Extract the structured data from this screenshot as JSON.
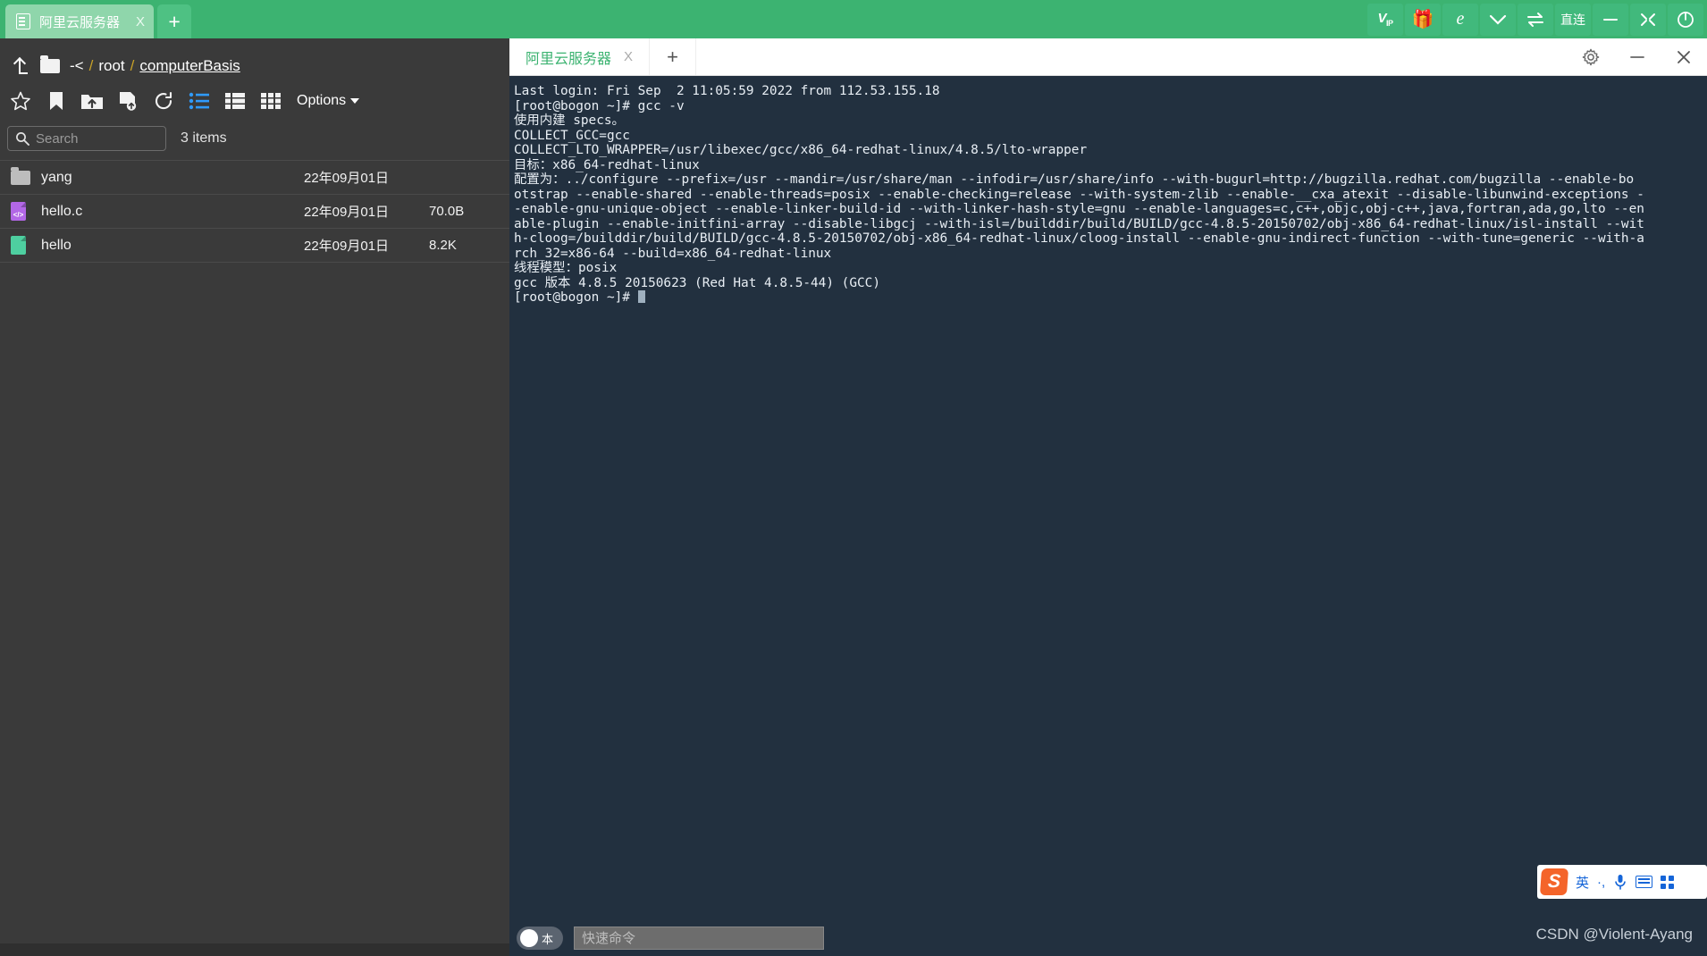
{
  "app": {
    "tab": {
      "title": "阿里云服务器",
      "close_label": "X",
      "icon": "server-icon"
    },
    "new_tab_label": "+",
    "tools": [
      {
        "name": "vip-button",
        "label": "V",
        "sub": "IP"
      },
      {
        "name": "gift-button",
        "label": "🎁"
      },
      {
        "name": "browser-button",
        "label": "e"
      },
      {
        "name": "chevron-down-button",
        "label": "⌄"
      },
      {
        "name": "transfer-button",
        "label": "⇆"
      },
      {
        "name": "direct-connect-button",
        "label": "直连"
      },
      {
        "name": "minimize-button",
        "label": "—"
      },
      {
        "name": "maximize-button",
        "label": "⤢"
      },
      {
        "name": "power-button",
        "label": "⏻"
      }
    ]
  },
  "filepanel": {
    "breadcrumb": {
      "prefix": "-<",
      "sep": "/",
      "root": "root",
      "current": "computerBasis"
    },
    "toolbar": {
      "icons": [
        "star-icon",
        "bookmark-icon",
        "upload-folder-icon",
        "new-file-icon",
        "refresh-icon",
        "list-view-icon",
        "detail-view-icon",
        "grid-view-icon"
      ],
      "options_label": "Options"
    },
    "search": {
      "placeholder": "Search",
      "value": ""
    },
    "items_count": "3 items",
    "files": [
      {
        "icon": "folder-icon",
        "name": "yang",
        "date": "22年09月01日",
        "size": ""
      },
      {
        "icon": "c-file-icon",
        "name": "hello.c",
        "date": "22年09月01日",
        "size": "70.0B"
      },
      {
        "icon": "bin-file-icon",
        "name": "hello",
        "date": "22年09月01日",
        "size": "8.2K"
      }
    ]
  },
  "terminal": {
    "tab": {
      "title": "阿里云服务器",
      "close_label": "X"
    },
    "new_tab_label": "+",
    "window_buttons": [
      {
        "name": "settings-button",
        "label": "gear-icon"
      },
      {
        "name": "minimize-button",
        "label": "—"
      },
      {
        "name": "close-button",
        "label": "✕"
      }
    ],
    "lines": [
      "Last login: Fri Sep  2 11:05:59 2022 from 112.53.155.18",
      "[root@bogon ~]# gcc -v",
      "使用内建 specs。",
      "COLLECT_GCC=gcc",
      "COLLECT_LTO_WRAPPER=/usr/libexec/gcc/x86_64-redhat-linux/4.8.5/lto-wrapper",
      "目标：x86_64-redhat-linux",
      "配置为：../configure --prefix=/usr --mandir=/usr/share/man --infodir=/usr/share/info --with-bugurl=http://bugzilla.redhat.com/bugzilla --enable-bo",
      "otstrap --enable-shared --enable-threads=posix --enable-checking=release --with-system-zlib --enable-__cxa_atexit --disable-libunwind-exceptions -",
      "-enable-gnu-unique-object --enable-linker-build-id --with-linker-hash-style=gnu --enable-languages=c,c++,objc,obj-c++,java,fortran,ada,go,lto --en",
      "able-plugin --enable-initfini-array --disable-libgcj --with-isl=/builddir/build/BUILD/gcc-4.8.5-20150702/obj-x86_64-redhat-linux/isl-install --wit",
      "h-cloog=/builddir/build/BUILD/gcc-4.8.5-20150702/obj-x86_64-redhat-linux/cloog-install --enable-gnu-indirect-function --with-tune=generic --with-a",
      "rch_32=x86-64 --build=x86_64-redhat-linux",
      "线程模型：posix",
      "gcc 版本 4.8.5 20150623 (Red Hat 4.8.5-44) (GCC)",
      "[root@bogon ~]# "
    ],
    "quick_command": {
      "toggle_label": "本",
      "placeholder": "快速命令",
      "value": ""
    }
  },
  "ime": {
    "logo": "S",
    "mode": "英",
    "punctuation": "·,",
    "mic": "mic-icon",
    "keyboard": "keyboard-icon",
    "menu": "grid-icon"
  },
  "watermark": "CSDN @Violent-Ayang",
  "colors": {
    "app_green": "#3cb371",
    "panel_dark": "#3a3a3a",
    "terminal_bg": "#22303f",
    "accent_blue": "#1565d8"
  }
}
